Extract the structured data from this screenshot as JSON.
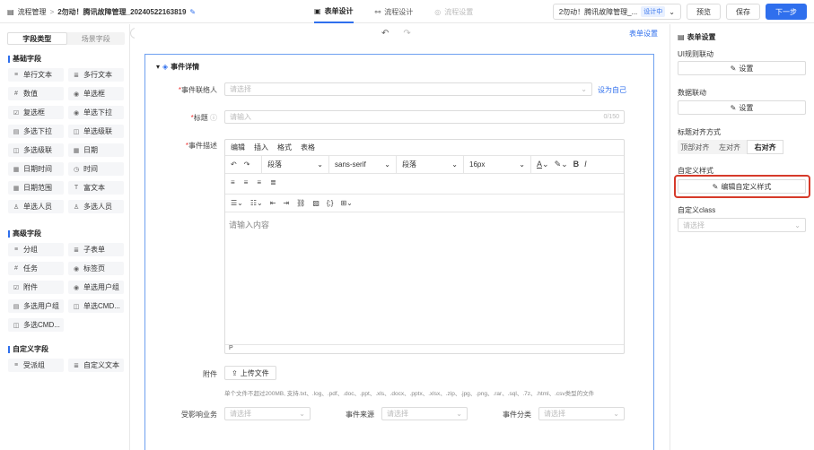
{
  "header": {
    "breadcrumb_root": "流程管理",
    "separator": ">",
    "title": "2勿动！腾讯故障管理_20240522163819",
    "tabs": [
      {
        "label": "表单设计"
      },
      {
        "label": "流程设计"
      },
      {
        "label": "流程设置"
      }
    ],
    "version_select": "2勿动！腾讯故障管理_...",
    "version_badge": "设计中",
    "preview": "预览",
    "save": "保存",
    "next": "下一步"
  },
  "sidebar": {
    "tabs": [
      "字段类型",
      "场景字段"
    ],
    "basic_title": "基础字段",
    "basic": [
      [
        "单行文本",
        "多行文本"
      ],
      [
        "数值",
        "单选框"
      ],
      [
        "复选框",
        "单选下拉"
      ],
      [
        "多选下拉",
        "单选级联"
      ],
      [
        "多选级联",
        "日期"
      ],
      [
        "日期时间",
        "时间"
      ],
      [
        "日期范围",
        "富文本"
      ],
      [
        "单选人员",
        "多选人员"
      ]
    ],
    "advanced_title": "高级字段",
    "advanced": [
      [
        "分组",
        "子表单"
      ],
      [
        "任务",
        "标签页"
      ],
      [
        "附件",
        "单选用户组"
      ],
      [
        "多选用户组",
        "单选CMD..."
      ],
      [
        "多选CMD...",
        ""
      ]
    ],
    "custom_title": "自定义字段",
    "custom": [
      [
        "受派组",
        "自定义文本"
      ]
    ]
  },
  "canvas": {
    "form_settings": "表单设置",
    "section": "事件详情",
    "contact_label": "事件联络人",
    "contact_ph": "请选择",
    "set_self": "设为自己",
    "title_label": "标题",
    "title_ph": "请输入",
    "title_count": "0/150",
    "desc_label": "事件描述",
    "editor": {
      "menu": [
        "编辑",
        "插入",
        "格式",
        "表格"
      ],
      "block1": "段落",
      "font": "sans-serif",
      "block2": "段落",
      "size": "16px",
      "placeholder": "请输入内容",
      "footer": "P"
    },
    "attach_label": "附件",
    "upload": "上传文件",
    "hint": "单个文件不超过200MB, 支持.txt、.log、.pdf、.doc、.ppt、.xls、.docx、.pptx、.xlsx、.zip、.jpg、.png、.rar、.sql、.7z、.html、.csv类型的文件",
    "row": [
      {
        "label": "受影响业务",
        "ph": "请选择"
      },
      {
        "label": "事件来源",
        "ph": "请选择"
      },
      {
        "label": "事件分类",
        "ph": "请选择"
      }
    ]
  },
  "panel": {
    "title": "表单设置",
    "ui_label": "UI规则联动",
    "set": "设置",
    "data_label": "数据联动",
    "align_label": "标题对齐方式",
    "align": [
      "顶部对齐",
      "左对齐",
      "右对齐"
    ],
    "style_label": "自定义样式",
    "edit_style": "编辑自定义样式",
    "class_label": "自定义class",
    "class_ph": "请选择"
  },
  "colors": {
    "accent": "#2f6fed",
    "highlight": "#d63a2a"
  }
}
